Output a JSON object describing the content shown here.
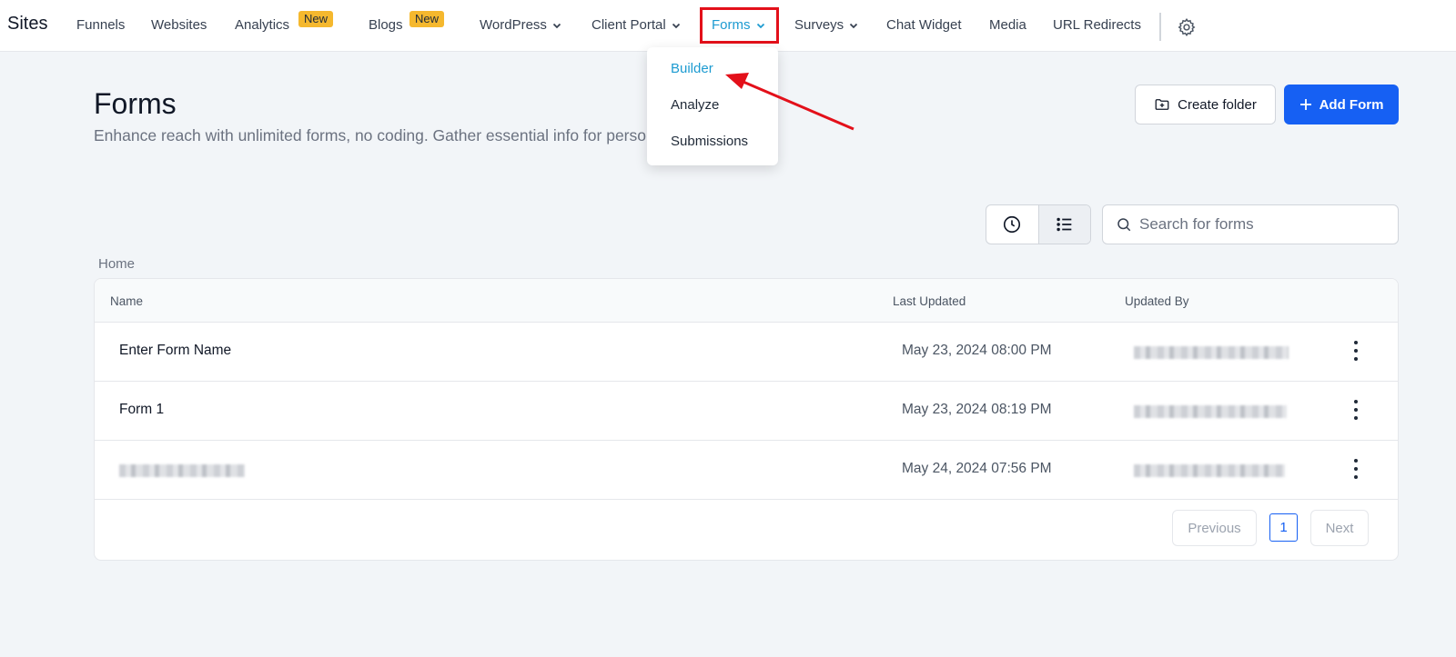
{
  "nav": {
    "brand": "Sites",
    "items": [
      {
        "label": "Funnels"
      },
      {
        "label": "Websites"
      },
      {
        "label": "Analytics",
        "badge": "New"
      },
      {
        "label": "Blogs",
        "badge": "New"
      },
      {
        "label": "WordPress"
      },
      {
        "label": "Client Portal"
      },
      {
        "label": "Forms"
      },
      {
        "label": "Surveys"
      },
      {
        "label": "Chat Widget"
      },
      {
        "label": "Media"
      },
      {
        "label": "URL Redirects"
      }
    ],
    "settings_icon": "gear-icon"
  },
  "dropdown": {
    "items": [
      {
        "label": "Builder"
      },
      {
        "label": "Analyze"
      },
      {
        "label": "Submissions"
      }
    ]
  },
  "header": {
    "title": "Forms",
    "subtitle": "Enhance reach with unlimited forms, no coding. Gather essential info for personalized content.",
    "create_folder": "Create folder",
    "add_form": "Add Form"
  },
  "search": {
    "placeholder": "Search for forms",
    "value": ""
  },
  "breadcrumb": "Home",
  "table": {
    "columns": {
      "name": "Name",
      "last_updated": "Last Updated",
      "updated_by": "Updated By"
    },
    "rows": [
      {
        "name": "Enter Form Name",
        "last_updated": "May 23, 2024 08:00 PM",
        "updated_by": ""
      },
      {
        "name": "Form 1",
        "last_updated": "May 23, 2024 08:19 PM",
        "updated_by": ""
      },
      {
        "name": "",
        "last_updated": "May 24, 2024 07:56 PM",
        "updated_by": ""
      }
    ]
  },
  "pagination": {
    "previous": "Previous",
    "current_page": "1",
    "next": "Next"
  },
  "colors": {
    "accent": "#1d9bd1",
    "primary_button": "#1660f3",
    "badge": "#f5b82e",
    "highlight": "#e3101a"
  }
}
